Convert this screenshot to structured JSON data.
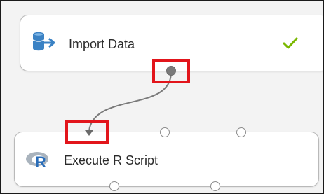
{
  "modules": {
    "import": {
      "label": "Import Data",
      "icon": "database-import-icon",
      "status_icon": "checkmark-icon",
      "status_color": "#7ab800"
    },
    "execute": {
      "label": "Execute R Script",
      "icon": "r-language-icon"
    }
  },
  "colors": {
    "highlight": "#e2151b",
    "icon_blue": "#3b82c4",
    "connector": "#7a7a7a"
  }
}
